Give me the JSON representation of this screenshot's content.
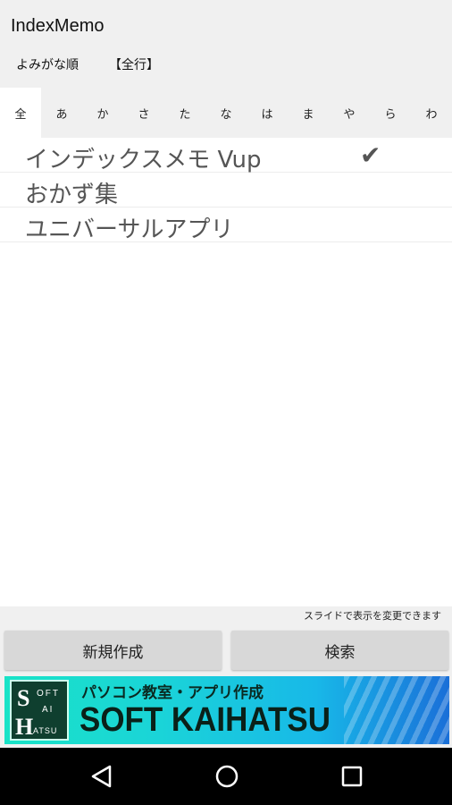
{
  "app": {
    "title": "IndexMemo"
  },
  "sortbar": {
    "sort_mode": "よみがな順",
    "row_filter": "【全行】"
  },
  "kana_tabs": [
    "全",
    "あ",
    "か",
    "さ",
    "た",
    "な",
    "は",
    "ま",
    "や",
    "ら",
    "わ"
  ],
  "memos": [
    {
      "title": "インデックスメモ  Vup",
      "checked": true,
      "check_mark": "✔"
    },
    {
      "title": "おかず集",
      "checked": false
    },
    {
      "title": "ユニバーサルアプリ",
      "checked": false
    }
  ],
  "hint": "スライドで表示を変更できます",
  "buttons": {
    "new_label": "新規作成",
    "search_label": "検索"
  },
  "ad": {
    "tagline": "パソコン教室・アプリ作成",
    "company": "SOFT KAIHATSU",
    "logo": {
      "l1": "S",
      "l2": "OFT",
      "l3": "AI",
      "l4": "H",
      "l5": "ATSU"
    }
  },
  "nav": {
    "back_icon": "triangle-back-icon",
    "home_icon": "circle-home-icon",
    "recent_icon": "square-recent-icon"
  }
}
